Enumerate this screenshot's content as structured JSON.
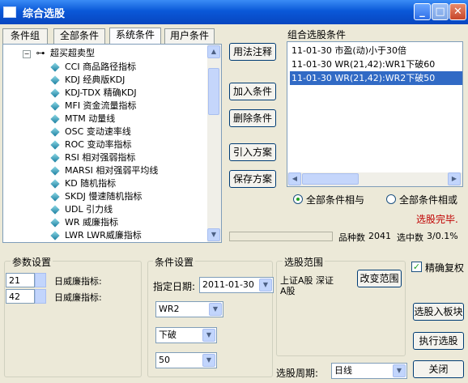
{
  "window": {
    "title": "综合选股"
  },
  "tabs": [
    "条件组",
    "全部条件",
    "系统条件",
    "用户条件"
  ],
  "tree": {
    "root_label": "超买超卖型",
    "items": [
      "CCI 商品路径指标",
      "KDJ 经典版KDJ",
      "KDJ-TDX 精确KDJ",
      "MFI 资金流量指标",
      "MTM 动量线",
      "OSC 变动速率线",
      "ROC 变动率指标",
      "RSI 相对强弱指标",
      "MARSI 相对强弱平均线",
      "KD 随机指标",
      "SKDJ 慢速随机指标",
      "UDL 引力线",
      "WR 威廉指标",
      "LWR LWR威廉指标"
    ]
  },
  "middle_buttons": {
    "usage": "用法注释",
    "add": "加入条件",
    "delete": "删除条件",
    "import": "引入方案",
    "save": "保存方案"
  },
  "conditions": {
    "label": "组合选股条件",
    "items": [
      "11-01-30 市盈(动)小于30倍",
      "11-01-30 WR(21,42):WR1下破60",
      "11-01-30 WR(21,42):WR2下破50"
    ],
    "selected_index": 2
  },
  "logic": {
    "and_label": "全部条件相与",
    "or_label": "全部条件相或",
    "selected": "and"
  },
  "status": {
    "done": "选股完毕.",
    "count_label": "品种数",
    "count": "2041",
    "hit_label": "选中数",
    "hit": "3/0.1%"
  },
  "params": {
    "title": "参数设置",
    "rows": [
      {
        "value": "21",
        "label": "日威廉指标:"
      },
      {
        "value": "42",
        "label": "日威廉指标:"
      }
    ]
  },
  "cond_settings": {
    "title": "条件设置",
    "date_label": "指定日期:",
    "date_value": "2011-01-30",
    "line_value": "WR2",
    "op_value": "下破",
    "num_value": "50"
  },
  "range": {
    "title": "选股范围",
    "text1": "上证A股 深证",
    "text2": "A股",
    "change_btn": "改变范围"
  },
  "right": {
    "exact_label": "精确复权",
    "exact_checked": true,
    "to_block": "选股入板块",
    "execute": "执行选股",
    "close": "关闭"
  },
  "period": {
    "label": "选股周期:",
    "value": "日线"
  },
  "colors": {
    "titlebar": "#0a58d8",
    "selection": "#316ac5",
    "status_red": "#c00000"
  }
}
